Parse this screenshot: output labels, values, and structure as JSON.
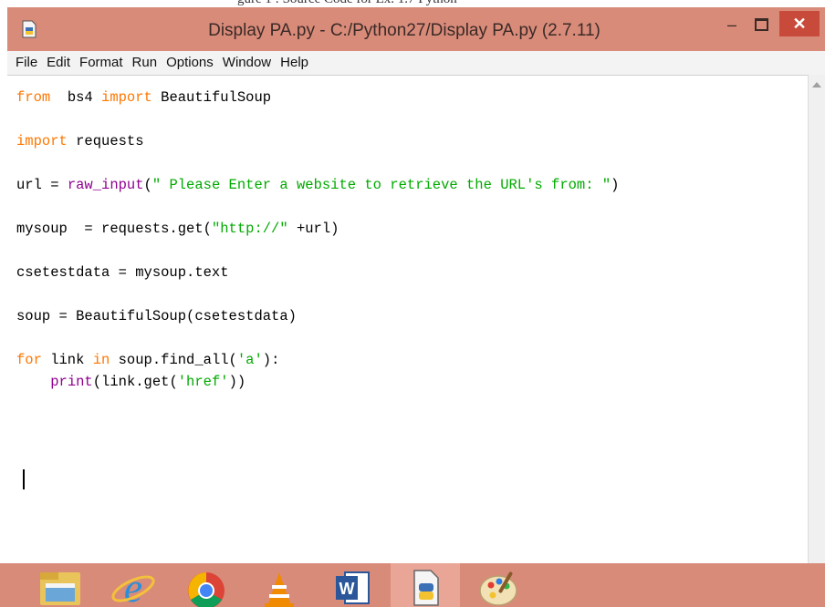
{
  "top_text": "gure 1 : Source Code for Ex. 1.7 Python",
  "window": {
    "title": "Display PA.py - C:/Python27/Display PA.py (2.7.11)",
    "minimize_label": "–",
    "close_label": "✕"
  },
  "menu": [
    "File",
    "Edit",
    "Format",
    "Run",
    "Options",
    "Window",
    "Help"
  ],
  "code": {
    "lines": [
      [
        [
          "kw",
          "from"
        ],
        [
          "",
          "  bs4 "
        ],
        [
          "kw",
          "import"
        ],
        [
          "",
          " BeautifulSoup"
        ]
      ],
      [],
      [
        [
          "kw",
          "import"
        ],
        [
          "",
          " requests"
        ]
      ],
      [],
      [
        [
          "",
          "url = "
        ],
        [
          "bi",
          "raw_input"
        ],
        [
          "",
          "("
        ],
        [
          "str",
          "\" Please Enter a website to retrieve the URL's from: \""
        ],
        [
          "",
          ")"
        ]
      ],
      [],
      [
        [
          "",
          "mysoup  = requests.get("
        ],
        [
          "str",
          "\"http://\""
        ],
        [
          "",
          " +url)"
        ]
      ],
      [],
      [
        [
          "",
          "csetestdata = mysoup.text"
        ]
      ],
      [],
      [
        [
          "",
          "soup = BeautifulSoup(csetestdata)"
        ]
      ],
      [],
      [
        [
          "kw",
          "for"
        ],
        [
          "",
          " link "
        ],
        [
          "kw",
          "in"
        ],
        [
          "",
          " soup.find_all("
        ],
        [
          "str",
          "'a'"
        ],
        [
          "",
          "):"
        ]
      ],
      [
        [
          "",
          "    "
        ],
        [
          "bi",
          "print"
        ],
        [
          "",
          "(link.get("
        ],
        [
          "str",
          "'href'"
        ],
        [
          "",
          "))"
        ]
      ]
    ]
  },
  "taskbar": {
    "items": [
      {
        "name": "file-explorer",
        "icon": "folder-icon"
      },
      {
        "name": "internet-explorer",
        "icon": "ie-icon"
      },
      {
        "name": "chrome",
        "icon": "chrome-icon"
      },
      {
        "name": "vlc",
        "icon": "vlc-icon"
      },
      {
        "name": "word",
        "icon": "word-icon"
      },
      {
        "name": "python-idle",
        "icon": "python-idle-icon",
        "active": true
      },
      {
        "name": "paint",
        "icon": "paint-icon"
      }
    ]
  },
  "colors": {
    "frame": "#d98b7a",
    "close_button": "#c84a3a",
    "keyword": "#ff7700",
    "builtin": "#900090",
    "string": "#00aa00"
  }
}
